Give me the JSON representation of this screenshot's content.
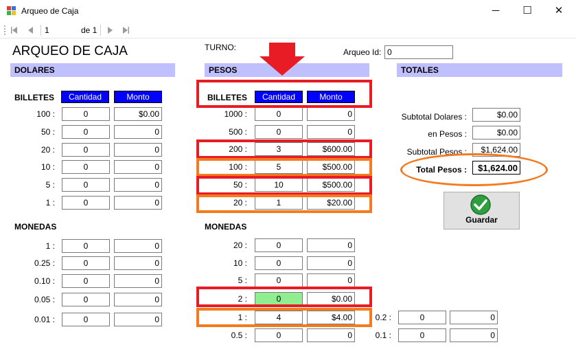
{
  "window": {
    "title": "Arqueo de Caja",
    "minimize_glyph": "─",
    "maximize_glyph": "☐",
    "close_glyph": "✕"
  },
  "navigator": {
    "position": "1",
    "of_label": "de 1",
    "icons": [
      "move-first-icon",
      "move-previous-icon",
      "move-next-icon",
      "move-last-icon"
    ]
  },
  "header": {
    "title": "ARQUEO DE CAJA",
    "turno_label": "TURNO:",
    "arqueo_id_label": "Arqueo Id:",
    "arqueo_id_value": "0"
  },
  "dolares": {
    "section": "DOLARES",
    "billetes_label": "BILLETES",
    "cantidad_header": "Cantidad",
    "monto_header": "Monto",
    "billetes": [
      {
        "label": "100 :",
        "cantidad": "0",
        "monto": "$0.00"
      },
      {
        "label": "50 :",
        "cantidad": "0",
        "monto": "0"
      },
      {
        "label": "20 :",
        "cantidad": "0",
        "monto": "0"
      },
      {
        "label": "10 :",
        "cantidad": "0",
        "monto": "0"
      },
      {
        "label": "5 :",
        "cantidad": "0",
        "monto": "0"
      },
      {
        "label": "1 :",
        "cantidad": "0",
        "monto": "0"
      }
    ],
    "monedas_label": "MONEDAS",
    "monedas": [
      {
        "label": "1 :",
        "cantidad": "0",
        "monto": "0"
      },
      {
        "label": "0.25 :",
        "cantidad": "0",
        "monto": "0"
      },
      {
        "label": "0.10 :",
        "cantidad": "0",
        "monto": "0"
      },
      {
        "label": "0.05 :",
        "cantidad": "0",
        "monto": "0"
      },
      {
        "label": "0.01 :",
        "cantidad": "0",
        "monto": "0"
      }
    ]
  },
  "pesos": {
    "section": "PESOS",
    "billetes_label": "BILLETES",
    "cantidad_header": "Cantidad",
    "monto_header": "Monto",
    "billetes": [
      {
        "label": "1000 :",
        "cantidad": "0",
        "monto": "0"
      },
      {
        "label": "500 :",
        "cantidad": "0",
        "monto": "0"
      },
      {
        "label": "200 :",
        "cantidad": "3",
        "monto": "$600.00"
      },
      {
        "label": "100 :",
        "cantidad": "5",
        "monto": "$500.00"
      },
      {
        "label": "50 :",
        "cantidad": "10",
        "monto": "$500.00"
      },
      {
        "label": "20 :",
        "cantidad": "1",
        "monto": "$20.00"
      }
    ],
    "monedas_label": "MONEDAS",
    "monedas": [
      {
        "label": "20 :",
        "cantidad": "0",
        "monto": "0"
      },
      {
        "label": "10 :",
        "cantidad": "0",
        "monto": "0"
      },
      {
        "label": "5 :",
        "cantidad": "0",
        "monto": "0"
      },
      {
        "label": "2 :",
        "cantidad": "0",
        "monto": "$0.00"
      },
      {
        "label": "1 :",
        "cantidad": "4",
        "monto": "$4.00"
      },
      {
        "label": "0.5 :",
        "cantidad": "0",
        "monto": "0"
      }
    ],
    "monedas_extra": [
      {
        "label": "0.2 :",
        "cantidad": "0",
        "monto": "0"
      },
      {
        "label": "0.1 :",
        "cantidad": "0",
        "monto": "0"
      }
    ]
  },
  "totales": {
    "section": "TOTALES",
    "subtotal_dolares_label": "Subtotal Dolares :",
    "subtotal_dolares_value": "$0.00",
    "en_pesos_label": "en Pesos :",
    "en_pesos_value": "$0.00",
    "subtotal_pesos_label": "Subtotal Pesos :",
    "subtotal_pesos_value": "$1,624.00",
    "total_pesos_label": "Total Pesos :",
    "total_pesos_value": "$1,624.00"
  },
  "save_label": "Guardar",
  "colors": {
    "section_header_bg": "#c0c0ff",
    "column_header_bg": "#0000ff",
    "highlight_red": "#e81c24",
    "highlight_orange": "#f47a20",
    "focused_cell_bg": "#90ee90",
    "check_green": "#2e9e3f"
  }
}
